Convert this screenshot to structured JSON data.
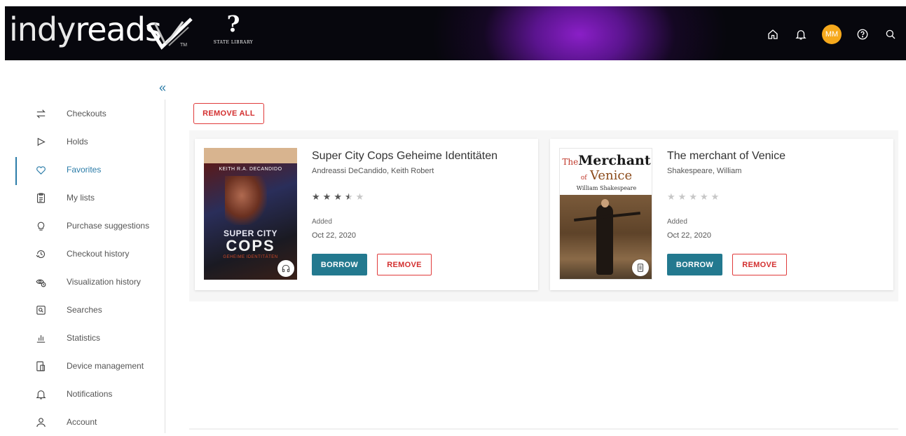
{
  "header": {
    "logo_part1": "indy",
    "logo_part2": "reads",
    "logo_tm": "TM",
    "state_library_label": "STATE LIBRARY",
    "avatar_initials": "MM",
    "icons": [
      "home-icon",
      "bell-icon",
      "help-icon",
      "search-icon"
    ]
  },
  "sidebar": {
    "collapse_label": "«",
    "items": [
      {
        "label": "Checkouts",
        "icon": "swap-icon"
      },
      {
        "label": "Holds",
        "icon": "flag-icon"
      },
      {
        "label": "Favorites",
        "icon": "heart-icon",
        "active": true
      },
      {
        "label": "My lists",
        "icon": "clipboard-icon"
      },
      {
        "label": "Purchase suggestions",
        "icon": "lightbulb-icon"
      },
      {
        "label": "Checkout history",
        "icon": "history-icon"
      },
      {
        "label": "Visualization history",
        "icon": "eye-history-icon"
      },
      {
        "label": "Searches",
        "icon": "search-box-icon"
      },
      {
        "label": "Statistics",
        "icon": "bar-chart-icon"
      },
      {
        "label": "Device management",
        "icon": "devices-icon"
      },
      {
        "label": "Notifications",
        "icon": "bell-icon"
      },
      {
        "label": "Account",
        "icon": "user-icon"
      }
    ]
  },
  "main": {
    "remove_all_label": "REMOVE ALL",
    "cards": [
      {
        "title": "Super City Cops Geheime Identitäten",
        "author": "Andreassi DeCandido, Keith Robert",
        "rating": 3.5,
        "added_label": "Added",
        "added_date": "Oct 22, 2020",
        "borrow_label": "BORROW",
        "remove_label": "REMOVE",
        "format_icon": "headphones-icon",
        "cover_author": "KEITH R.A. DECANDIDO",
        "cover_title_1": "SUPER CITY",
        "cover_title_2": "COPS",
        "cover_subtitle": "GEHEIME IDENTITÄTEN"
      },
      {
        "title": "The merchant of Venice",
        "author": "Shakespeare, William",
        "rating": 0,
        "added_label": "Added",
        "added_date": "Oct 22, 2020",
        "borrow_label": "BORROW",
        "remove_label": "REMOVE",
        "format_icon": "ebook-icon",
        "cover_the": "The",
        "cover_merchant": "Merchant",
        "cover_of": "of",
        "cover_venice": "Venice",
        "cover_author": "William Shakespeare"
      }
    ]
  },
  "colors": {
    "accent": "#2b7ca8",
    "borrow": "#23798f",
    "danger": "#d32f2f",
    "avatar": "#f6a91c"
  }
}
